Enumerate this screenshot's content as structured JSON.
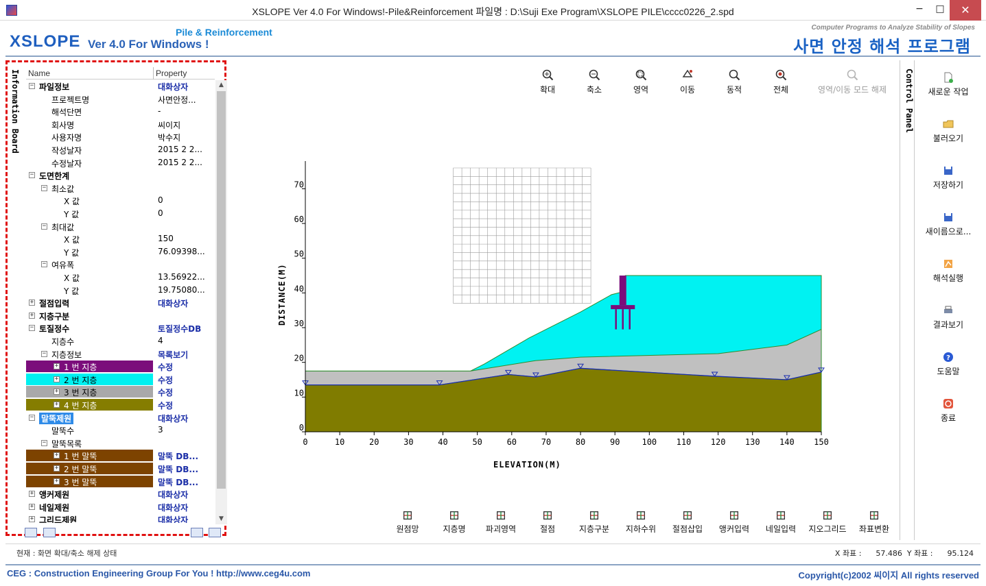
{
  "window": {
    "title": "XSLOPE Ver 4.0 For Windows!-Pile&Reinforcement  파일명 : D:\\Suji Exe Program\\XSLOPE PILE\\cccc0226_2.spd",
    "minimize": "−",
    "maximize": "□",
    "close": "✕"
  },
  "header": {
    "logo_xs": "XS",
    "logo_lope": "LOPE",
    "logo_ver": "Ver 4.0 For Windows !",
    "logo_pile": "Pile & Reinforcement",
    "cp_text": "Computer Programs to Analyze Stability of Slopes",
    "kr_title": "사면 안정 해석 프로그램"
  },
  "left_panel": {
    "tab_label": "Information Board",
    "col_name": "Name",
    "col_property": "Property",
    "rows": [
      {
        "name": "파일정보",
        "prop": "대화상자",
        "level": 0,
        "exp": "−",
        "bold": true,
        "link": true
      },
      {
        "name": "프로젝트명",
        "prop": "사면안정...",
        "level": 1
      },
      {
        "name": "해석단면",
        "prop": "-",
        "level": 1
      },
      {
        "name": "회사명",
        "prop": "씨이지",
        "level": 1
      },
      {
        "name": "사용자명",
        "prop": "박수지",
        "level": 1
      },
      {
        "name": "작성날자",
        "prop": "2015 2 2...",
        "level": 1
      },
      {
        "name": "수정날자",
        "prop": "2015 2 2...",
        "level": 1
      },
      {
        "name": "도면한계",
        "prop": "",
        "level": 0,
        "exp": "−",
        "bold": true
      },
      {
        "name": "최소값",
        "prop": "",
        "level": 1,
        "exp": "−"
      },
      {
        "name": "X 값",
        "prop": "0",
        "level": 2
      },
      {
        "name": "Y 값",
        "prop": "0",
        "level": 2
      },
      {
        "name": "최대값",
        "prop": "",
        "level": 1,
        "exp": "−"
      },
      {
        "name": "X 값",
        "prop": "150",
        "level": 2
      },
      {
        "name": "Y 값",
        "prop": "76.09398...",
        "level": 2
      },
      {
        "name": "여유폭",
        "prop": "",
        "level": 1,
        "exp": "−"
      },
      {
        "name": "X 값",
        "prop": "13.56922...",
        "level": 2
      },
      {
        "name": "Y 값",
        "prop": "19.75080...",
        "level": 2
      },
      {
        "name": "절점입력",
        "prop": "대화상자",
        "level": 0,
        "exp": "+",
        "bold": true,
        "link": true
      },
      {
        "name": "지층구분",
        "prop": "",
        "level": 0,
        "exp": "+",
        "bold": true
      },
      {
        "name": "토질정수",
        "prop": "토질정수DB",
        "level": 0,
        "exp": "−",
        "bold": true,
        "link": true
      },
      {
        "name": "지층수",
        "prop": "4",
        "level": 1
      },
      {
        "name": "지층정보",
        "prop": "목록보기",
        "level": 1,
        "exp": "−",
        "link": true
      },
      {
        "name": "1 번 지층",
        "prop": "수정",
        "level": 2,
        "exp": "+",
        "bar": "#7b0d7b",
        "link": true
      },
      {
        "name": "2 번 지층",
        "prop": "수정",
        "level": 2,
        "exp": "+",
        "bar": "#00f0f0",
        "link": true,
        "dark": true
      },
      {
        "name": "3 번 지층",
        "prop": "수정",
        "level": 2,
        "exp": "+",
        "bar": "#a9a9a9",
        "link": true,
        "dark": true
      },
      {
        "name": "4 번 지층",
        "prop": "수정",
        "level": 2,
        "exp": "+",
        "bar": "#857d00",
        "link": true
      },
      {
        "name": "말뚝제원",
        "prop": "대화상자",
        "level": 0,
        "exp": "−",
        "sel": true,
        "link": true
      },
      {
        "name": "말뚝수",
        "prop": "3",
        "level": 1
      },
      {
        "name": "말뚝목록",
        "prop": "",
        "level": 1,
        "exp": "−"
      },
      {
        "name": "1 번 말뚝",
        "prop": "말뚝 DB...",
        "level": 2,
        "exp": "+",
        "bar": "#7d4300",
        "link": true
      },
      {
        "name": "2 번 말뚝",
        "prop": "말뚝 DB...",
        "level": 2,
        "exp": "+",
        "bar": "#7d4300",
        "link": true
      },
      {
        "name": "3 번 말뚝",
        "prop": "말뚝 DB...",
        "level": 2,
        "exp": "+",
        "bar": "#7d4300",
        "link": true
      },
      {
        "name": "앵커제원",
        "prop": "대화상자",
        "level": 0,
        "exp": "+",
        "bold": true,
        "link": true
      },
      {
        "name": "네일제원",
        "prop": "대화상자",
        "level": 0,
        "exp": "+",
        "bold": true,
        "link": true
      },
      {
        "name": "그리드제원",
        "prop": "대화상자",
        "level": 0,
        "exp": "+",
        "bold": true,
        "link": true
      }
    ]
  },
  "top_toolbar": [
    {
      "label": "확대",
      "icon": "zoom-in-icon"
    },
    {
      "label": "축소",
      "icon": "zoom-out-icon"
    },
    {
      "label": "영역",
      "icon": "zoom-area-icon"
    },
    {
      "label": "이동",
      "icon": "pan-icon"
    },
    {
      "label": "동적",
      "icon": "dynamic-zoom-icon"
    },
    {
      "label": "전체",
      "icon": "zoom-all-icon"
    },
    {
      "label": "영역/이동 모드 해제",
      "icon": "release-mode-icon",
      "disabled": true
    }
  ],
  "bottom_toolbar": [
    {
      "label": "원점망",
      "icon": "origin-grid-icon"
    },
    {
      "label": "지층명",
      "icon": "layer-name-icon"
    },
    {
      "label": "파괴영역",
      "icon": "failure-zone-icon"
    },
    {
      "label": "절점",
      "icon": "node-icon"
    },
    {
      "label": "지층구분",
      "icon": "layer-division-icon"
    },
    {
      "label": "지하수위",
      "icon": "water-table-icon"
    },
    {
      "label": "절점삽입",
      "icon": "node-insert-icon"
    },
    {
      "label": "앵커입력",
      "icon": "anchor-input-icon"
    },
    {
      "label": "네일입력",
      "icon": "nail-input-icon"
    },
    {
      "label": "지오그리드",
      "icon": "geogrid-icon"
    },
    {
      "label": "좌표변환",
      "icon": "coordinate-transform-icon"
    }
  ],
  "right_panel": {
    "tab_label": "Control Panel",
    "buttons": [
      {
        "label": "새로운 작업",
        "icon": "new-file-icon"
      },
      {
        "label": "불러오기",
        "icon": "open-folder-icon"
      },
      {
        "label": "저장하기",
        "icon": "save-icon"
      },
      {
        "label": "새이름으로...",
        "icon": "save-as-icon"
      },
      {
        "label": "해석실행",
        "icon": "run-analysis-icon"
      },
      {
        "label": "결과보기",
        "icon": "print-result-icon"
      },
      {
        "label": "도움말",
        "icon": "help-icon"
      },
      {
        "label": "종료",
        "icon": "exit-icon"
      }
    ]
  },
  "chart_data": {
    "type": "area",
    "xlabel": "ELEVATION(M)",
    "ylabel": "DISTANCE(M)",
    "xlim": [
      0,
      150
    ],
    "ylim": [
      0,
      76
    ],
    "xticks": [
      0,
      10,
      20,
      30,
      40,
      50,
      60,
      70,
      80,
      90,
      100,
      110,
      120,
      130,
      140,
      150
    ],
    "yticks": [
      0,
      10,
      20,
      30,
      40,
      50,
      60,
      70
    ],
    "layers": [
      {
        "name": "layer-4",
        "color": "#807c00",
        "top": [
          [
            0,
            13.5
          ],
          [
            39,
            13.5
          ],
          [
            59,
            16.5
          ],
          [
            67,
            15.8
          ],
          [
            80,
            18.3
          ],
          [
            119,
            16
          ],
          [
            140,
            15
          ],
          [
            150,
            17.2
          ]
        ]
      },
      {
        "name": "layer-3",
        "color": "#c0c0c0",
        "top": [
          [
            0,
            17.5
          ],
          [
            48,
            17.5
          ],
          [
            67,
            20.5
          ],
          [
            80,
            21.5
          ],
          [
            120,
            22.5
          ],
          [
            140,
            25
          ],
          [
            150,
            29.5
          ]
        ]
      },
      {
        "name": "layer-2",
        "color": "#00f2f2",
        "top": [
          [
            0,
            17.5
          ],
          [
            48,
            17.5
          ],
          [
            52,
            19.5
          ],
          [
            65,
            27
          ],
          [
            80,
            34.5
          ],
          [
            89,
            39.5
          ],
          [
            93,
            40.5
          ],
          [
            93,
            45
          ],
          [
            150,
            45
          ]
        ]
      }
    ],
    "water_table": [
      [
        0,
        13.5
      ],
      [
        39,
        13.5
      ],
      [
        59,
        16.5
      ],
      [
        67,
        15.8
      ],
      [
        80,
        18.3
      ],
      [
        119,
        16
      ],
      [
        140,
        15
      ],
      [
        150,
        17.2
      ]
    ],
    "water_markers": [
      0,
      39,
      59,
      67,
      80,
      119,
      140,
      150
    ],
    "grid_box": {
      "x": [
        43,
        83
      ],
      "y": [
        37,
        76
      ],
      "nx": 16,
      "ny": 16
    },
    "pile": {
      "x": 92.3,
      "cap_top": 45,
      "cap_bottom": 36.5,
      "tip": 29.5,
      "offsets": [
        -2,
        0,
        2
      ]
    }
  },
  "status": {
    "text": "현재 : 화면 확대/축소 해제 상태",
    "coord": "X 좌표 :      57.486  Y 좌표 :      95.124"
  },
  "footer": {
    "left": "CEG : Construction Engineering Group For You ! http://www.ceg4u.com",
    "right": "Copyright(c)2002 씨이지 All rights reserved"
  },
  "colors": {
    "pile": "#7b0d7b",
    "water": "#1a2db0",
    "accent": "#1a62c4",
    "highlight": "#e01010"
  }
}
